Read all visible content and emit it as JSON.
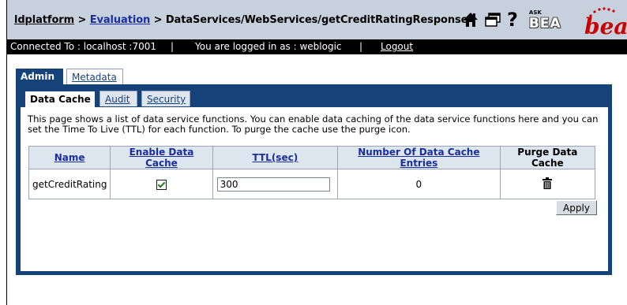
{
  "header": {
    "breadcrumb": {
      "root": "ldplatform",
      "sep1": " > ",
      "app": "Evaluation",
      "sep2": " > ",
      "path": "DataServices/WebServices/getCreditRatingResponse"
    },
    "icons": [
      "home-icon",
      "windows-icon",
      "help-icon"
    ],
    "ask_prefix": "ASK",
    "ask_brand": "BEA",
    "logo_text": "bea"
  },
  "status_bar": {
    "connected_to": "Connected To :  localhost :7001",
    "separator": "|",
    "logged_in": "You are logged in as :  weblogic",
    "logout": "Logout"
  },
  "outer_tabs": [
    {
      "label": "Admin",
      "active": true
    },
    {
      "label": "Metadata",
      "active": false
    }
  ],
  "inner_tabs": [
    {
      "label": "Data Cache",
      "active": true
    },
    {
      "label": "Audit",
      "active": false
    },
    {
      "label": "Security",
      "active": false
    }
  ],
  "description": "This page shows a list of data service functions. You can enable data caching of the data service functions here and you can set the Time To Live (TTL) for each function. To purge the cache use the purge icon.",
  "table": {
    "columns": [
      "Name",
      "Enable Data Cache",
      "TTL(sec)",
      "Number Of Data Cache Entries",
      "Purge Data Cache"
    ],
    "rows": [
      {
        "name": "getCreditRating",
        "enable_data_cache": true,
        "ttl": "300",
        "entries": "0",
        "purge_icon": "trash-icon"
      }
    ]
  },
  "apply_label": "Apply",
  "colors": {
    "header_bg": "#c7d1de",
    "panel_blue": "#16427a",
    "link_blue": "#1a2e9e",
    "logo_red": "#cc0000"
  }
}
